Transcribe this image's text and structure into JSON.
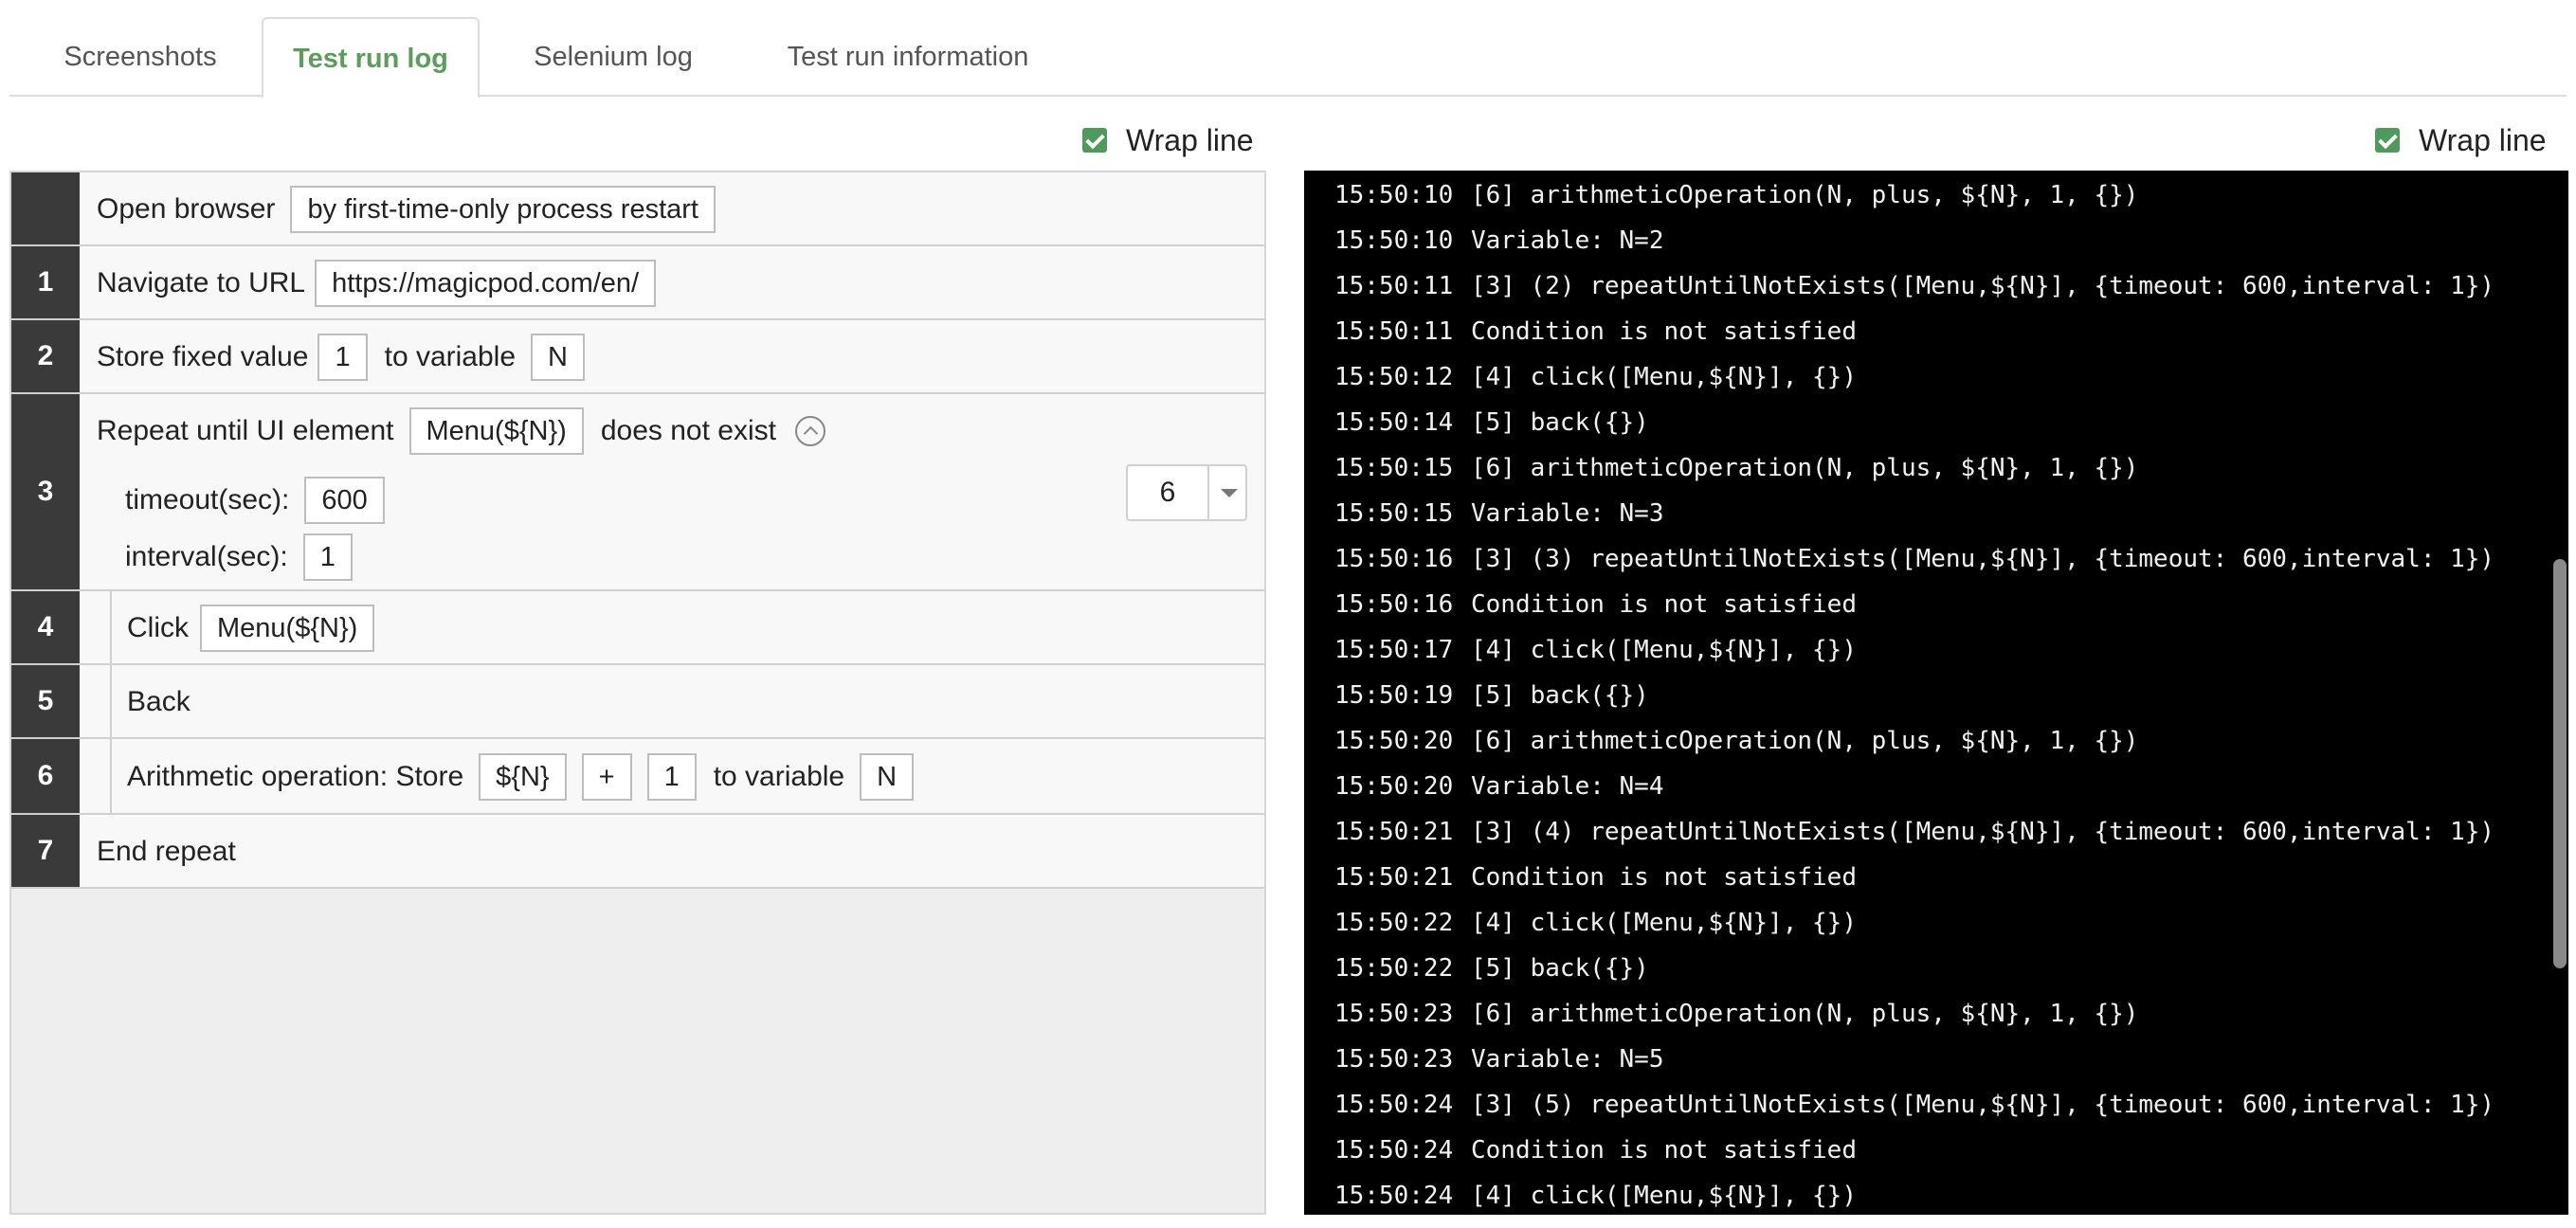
{
  "tabs": [
    {
      "label": "Screenshots"
    },
    {
      "label": "Test run log"
    },
    {
      "label": "Selenium log"
    },
    {
      "label": "Test run information"
    }
  ],
  "wrap_label": "Wrap line",
  "steps": {
    "open_browser": {
      "label": "Open browser",
      "value": "by first-time-only process restart"
    },
    "s1": {
      "num": "1",
      "label": "Navigate to URL",
      "value": "https://magicpod.com/en/"
    },
    "s2": {
      "num": "2",
      "label": "Store fixed value",
      "value": "1",
      "to_variable": "to variable",
      "var": "N"
    },
    "s3": {
      "num": "3",
      "label": "Repeat until UI element",
      "element": "Menu(${N})",
      "suffix": "does not exist",
      "timeout_label": "timeout(sec):",
      "timeout": "600",
      "interval_label": "interval(sec):",
      "interval": "1",
      "end_step": "6"
    },
    "s4": {
      "num": "4",
      "label": "Click",
      "element": "Menu(${N})"
    },
    "s5": {
      "num": "5",
      "label": "Back"
    },
    "s6": {
      "num": "6",
      "label": "Arithmetic operation: Store",
      "operand1": "${N}",
      "operator": "+",
      "operand2": "1",
      "to_variable": "to variable",
      "var": "N"
    },
    "s7": {
      "num": "7",
      "label": "End repeat"
    }
  },
  "log_lines": [
    {
      "ts": "15:50:10",
      "msg": "[6] arithmeticOperation(N, plus, ${N}, 1, {})"
    },
    {
      "ts": "15:50:10",
      "msg": "Variable: N=2"
    },
    {
      "ts": "15:50:11",
      "msg": "[3] (2) repeatUntilNotExists([Menu,${N}], {timeout: 600,interval: 1})"
    },
    {
      "ts": "15:50:11",
      "msg": "Condition is not satisfied"
    },
    {
      "ts": "15:50:12",
      "msg": "[4] click([Menu,${N}], {})"
    },
    {
      "ts": "15:50:14",
      "msg": "[5] back({})"
    },
    {
      "ts": "15:50:15",
      "msg": "[6] arithmeticOperation(N, plus, ${N}, 1, {})"
    },
    {
      "ts": "15:50:15",
      "msg": "Variable: N=3"
    },
    {
      "ts": "15:50:16",
      "msg": "[3] (3) repeatUntilNotExists([Menu,${N}], {timeout: 600,interval: 1})"
    },
    {
      "ts": "15:50:16",
      "msg": "Condition is not satisfied"
    },
    {
      "ts": "15:50:17",
      "msg": "[4] click([Menu,${N}], {})"
    },
    {
      "ts": "15:50:19",
      "msg": "[5] back({})"
    },
    {
      "ts": "15:50:20",
      "msg": "[6] arithmeticOperation(N, plus, ${N}, 1, {})"
    },
    {
      "ts": "15:50:20",
      "msg": "Variable: N=4"
    },
    {
      "ts": "15:50:21",
      "msg": "[3] (4) repeatUntilNotExists([Menu,${N}], {timeout: 600,interval: 1})"
    },
    {
      "ts": "15:50:21",
      "msg": "Condition is not satisfied"
    },
    {
      "ts": "15:50:22",
      "msg": "[4] click([Menu,${N}], {})"
    },
    {
      "ts": "15:50:22",
      "msg": "[5] back({})"
    },
    {
      "ts": "15:50:23",
      "msg": "[6] arithmeticOperation(N, plus, ${N}, 1, {})"
    },
    {
      "ts": "15:50:23",
      "msg": "Variable: N=5"
    },
    {
      "ts": "15:50:24",
      "msg": "[3] (5) repeatUntilNotExists([Menu,${N}], {timeout: 600,interval: 1})"
    },
    {
      "ts": "15:50:24",
      "msg": "Condition is not satisfied"
    },
    {
      "ts": "15:50:24",
      "msg": "[4] click([Menu,${N}], {})"
    }
  ]
}
